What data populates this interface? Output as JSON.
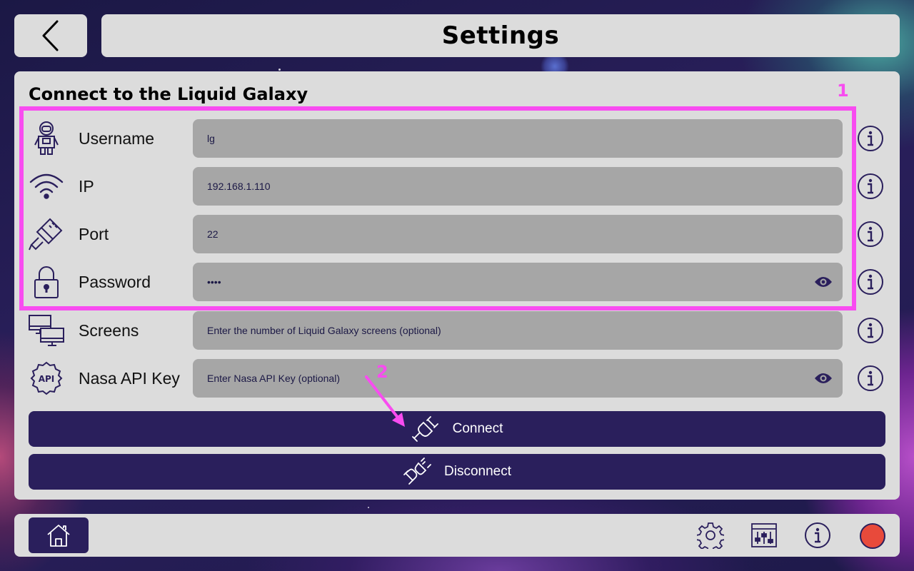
{
  "header": {
    "title": "Settings"
  },
  "connection": {
    "section_title": "Connect to the Liquid Galaxy",
    "fields": {
      "username": {
        "label": "Username",
        "value": "lg",
        "placeholder": ""
      },
      "ip": {
        "label": "IP",
        "value": "192.168.1.110",
        "placeholder": ""
      },
      "port": {
        "label": "Port",
        "value": "22",
        "placeholder": ""
      },
      "password": {
        "label": "Password",
        "value": "••••",
        "placeholder": ""
      },
      "screens": {
        "label": "Screens",
        "value": "",
        "placeholder": "Enter the number of Liquid Galaxy screens (optional)"
      },
      "nasa_api_key": {
        "label": "Nasa API Key",
        "value": "",
        "placeholder": "Enter Nasa API Key (optional)"
      }
    },
    "connect_label": "Connect",
    "disconnect_label": "Disconnect"
  },
  "annotations": {
    "box_number": "1",
    "arrow_number": "2",
    "color": "#f84cf0"
  },
  "colors": {
    "primary": "#2a1f5c",
    "panel": "#dcdcdc",
    "input": "#a6a6a6",
    "record": "#e84a3b"
  },
  "icons": {
    "back": "chevron-left-icon",
    "username": "astronaut-icon",
    "ip": "wifi-icon",
    "port": "ethernet-cable-icon",
    "password": "padlock-icon",
    "screens": "monitors-icon",
    "nasa_api_key": "api-badge-icon",
    "info": "info-icon",
    "eye": "eye-icon",
    "connect": "plug-connect-icon",
    "disconnect": "plug-disconnect-icon",
    "home": "home-icon",
    "settings": "gear-icon",
    "mixer": "sliders-icon",
    "about": "info-icon",
    "record": "record-dot"
  }
}
